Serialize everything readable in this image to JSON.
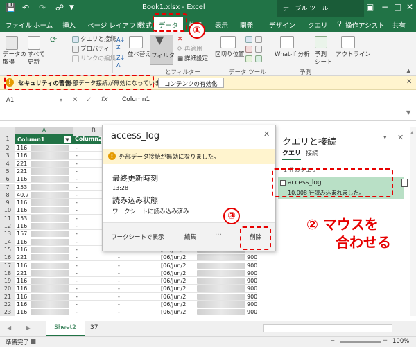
{
  "titlebar": {
    "title": "Book1.xlsx  -  Excel",
    "context_tools": "テーブル ツール",
    "minimize": "−",
    "restore": "□",
    "close": "✕"
  },
  "tabs": {
    "file": "ファイル",
    "home": "ホーム",
    "insert": "挿入",
    "page_layout": "ページ レイアウト",
    "formulas": "数式",
    "data": "データ",
    "review": "校閲",
    "view": "表示",
    "developer": "開発",
    "design": "デザイン",
    "query": "クエリ",
    "tell_me": "操作アシスト",
    "share": "共有"
  },
  "ribbon": {
    "get_data": "データの\n取得",
    "refresh_all": "すべて\n更新",
    "queries_connections": "クエリと接続",
    "properties": "プロパティ",
    "edit_links": "リンクの編集",
    "sort": "並べ替え",
    "filter": "フィルター",
    "reapply": "再適用",
    "advanced": "詳細設定",
    "text_to_columns": "区切り位置",
    "what_if": "What-If 分析",
    "forecast_sheet": "予測\nシート",
    "outline": "アウトライン",
    "group_filter": "とフィルター",
    "group_data_tools": "データ ツール",
    "group_forecast": "予測"
  },
  "security_bar": {
    "title": "セキュリティの警告",
    "message": "外部データ接続が無効になっています",
    "button": "コンテンツの有効化",
    "close": "✕"
  },
  "formula_bar": {
    "name_box": "A1",
    "cancel": "✕",
    "enter": "✓",
    "fx": "fx",
    "content": "Column1"
  },
  "grid": {
    "columns": [
      "A",
      "B"
    ],
    "header_cells": {
      "a": "Column1",
      "b": "Column2"
    },
    "rows": [
      {
        "n": "2",
        "a": "116",
        "b": "-",
        "c": "",
        "d": "",
        "e": ""
      },
      {
        "n": "3",
        "a": "116",
        "b": "-",
        "c": "",
        "d": "",
        "e": ""
      },
      {
        "n": "4",
        "a": "221",
        "b": "-",
        "c": "",
        "d": "",
        "e": ""
      },
      {
        "n": "5",
        "a": "221",
        "b": "-",
        "c": "",
        "d": "",
        "e": ""
      },
      {
        "n": "6",
        "a": "116",
        "b": "-",
        "c": "",
        "d": "",
        "e": ""
      },
      {
        "n": "7",
        "a": "153",
        "b": "-",
        "c": "",
        "d": "",
        "e": ""
      },
      {
        "n": "8",
        "a": "40.7",
        "b": "-",
        "c": "",
        "d": "",
        "e": ""
      },
      {
        "n": "9",
        "a": "116",
        "b": "-",
        "c": "",
        "d": "",
        "e": ""
      },
      {
        "n": "10",
        "a": "116",
        "b": "-",
        "c": "",
        "d": "",
        "e": ""
      },
      {
        "n": "11",
        "a": "153",
        "b": "-",
        "c": "",
        "d": "",
        "e": ""
      },
      {
        "n": "12",
        "a": "116",
        "b": "-",
        "c": "",
        "d": "",
        "e": ""
      },
      {
        "n": "13",
        "a": "157",
        "b": "-",
        "c": "",
        "d": "",
        "e": ""
      },
      {
        "n": "14",
        "a": "116",
        "b": "-",
        "c": "-",
        "d": "[06/Jun/2",
        "e": "900]"
      },
      {
        "n": "15",
        "a": "116",
        "b": "-",
        "c": "-",
        "d": "[06/Jun/2",
        "e": "900]"
      },
      {
        "n": "16",
        "a": "221",
        "b": "-",
        "c": "-",
        "d": "[06/Jun/2",
        "e": "900]"
      },
      {
        "n": "17",
        "a": "116",
        "b": "-",
        "c": "-",
        "d": "[06/Jun/2",
        "e": "900]"
      },
      {
        "n": "18",
        "a": "221",
        "b": "-",
        "c": "-",
        "d": "[06/Jun/2",
        "e": "900]"
      },
      {
        "n": "19",
        "a": "116",
        "b": "-",
        "c": "-",
        "d": "[06/Jun/2",
        "e": "900]"
      },
      {
        "n": "20",
        "a": "116",
        "b": "-",
        "c": "-",
        "d": "[06/Jun/2",
        "e": "900]"
      },
      {
        "n": "21",
        "a": "116",
        "b": "-",
        "c": "-",
        "d": "[06/Jun/2",
        "e": "900]"
      },
      {
        "n": "22",
        "a": "116",
        "b": "-",
        "c": "-",
        "d": "[06/Jun/2",
        "e": "900]"
      },
      {
        "n": "23",
        "a": "116",
        "b": "-",
        "c": "-",
        "d": "[06/Jun/2",
        "e": "900]"
      }
    ]
  },
  "pane": {
    "title": "クエリと接続",
    "tab_queries": "クエリ",
    "tab_connections": "接続",
    "count_label": "1 件のクエリ",
    "query_name": "access_log",
    "query_status": "10,008 行読み込まれました。",
    "close": "✕",
    "scroll_up": "▲"
  },
  "popup": {
    "title": "access_log",
    "close": "✕",
    "warning": "外部データ接続が無効になりました。",
    "last_refresh_label": "最終更新時刻",
    "last_refresh_value": "13:28",
    "load_status_label": "読み込み状態",
    "load_status_value": "ワークシートに読み込み済み",
    "btn_view": "ワークシートで表示",
    "btn_edit": "編集",
    "btn_more": "···",
    "btn_delete": "削除"
  },
  "sheet_tabs": {
    "sheet2": "Sheet2",
    "sheet37": "37",
    "add": "+",
    "prev": "◀",
    "next": "▶"
  },
  "status_bar": {
    "ready": "準備完了",
    "zoom": "100%",
    "zoom_minus": "−",
    "zoom_plus": "+"
  },
  "annotations": {
    "n1": "①",
    "n2_text": "②  マウスを",
    "n2_text2": "合わせる",
    "n3": "③"
  },
  "colors": {
    "excel_green": "#217346",
    "annotation_red": "#e60000",
    "warning_yellow": "#fff4ce",
    "query_tile": "#b9e0c6"
  }
}
